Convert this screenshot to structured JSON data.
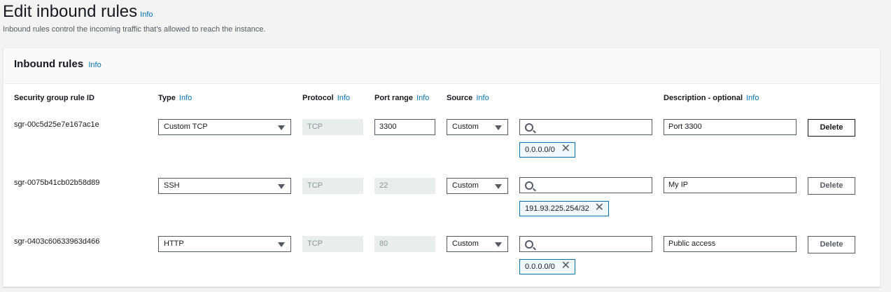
{
  "header": {
    "title": "Edit inbound rules",
    "title_info": "Info",
    "description": "Inbound rules control the incoming traffic that's allowed to reach the instance."
  },
  "panel": {
    "title": "Inbound rules",
    "title_info": "Info"
  },
  "columns": {
    "rule_id": "Security group rule ID",
    "type": "Type",
    "protocol": "Protocol",
    "port_range": "Port range",
    "source": "Source",
    "description": "Description - optional",
    "info": "Info"
  },
  "rules": [
    {
      "id": "sgr-00c5d25e7e167ac1e",
      "type": "Custom TCP",
      "protocol": "TCP",
      "port_range": "3300",
      "source_type": "Custom",
      "source_search": "",
      "cidr": "0.0.0.0/0",
      "description": "Port 3300",
      "delete_label": "Delete"
    },
    {
      "id": "sgr-0075b41cb02b58d89",
      "type": "SSH",
      "protocol": "TCP",
      "port_range": "22",
      "source_type": "Custom",
      "source_search": "",
      "cidr": "191.93.225.254/32",
      "description": "My IP",
      "delete_label": "Delete"
    },
    {
      "id": "sgr-0403c60633963d466",
      "type": "HTTP",
      "protocol": "TCP",
      "port_range": "80",
      "source_type": "Custom",
      "source_search": "",
      "cidr": "0.0.0.0/0",
      "description": "Public access",
      "delete_label": "Delete"
    }
  ],
  "colors": {
    "link": "#0073bb",
    "border": "#545b64",
    "disabled_bg": "#eaeded",
    "token_bg": "#f1faff"
  }
}
